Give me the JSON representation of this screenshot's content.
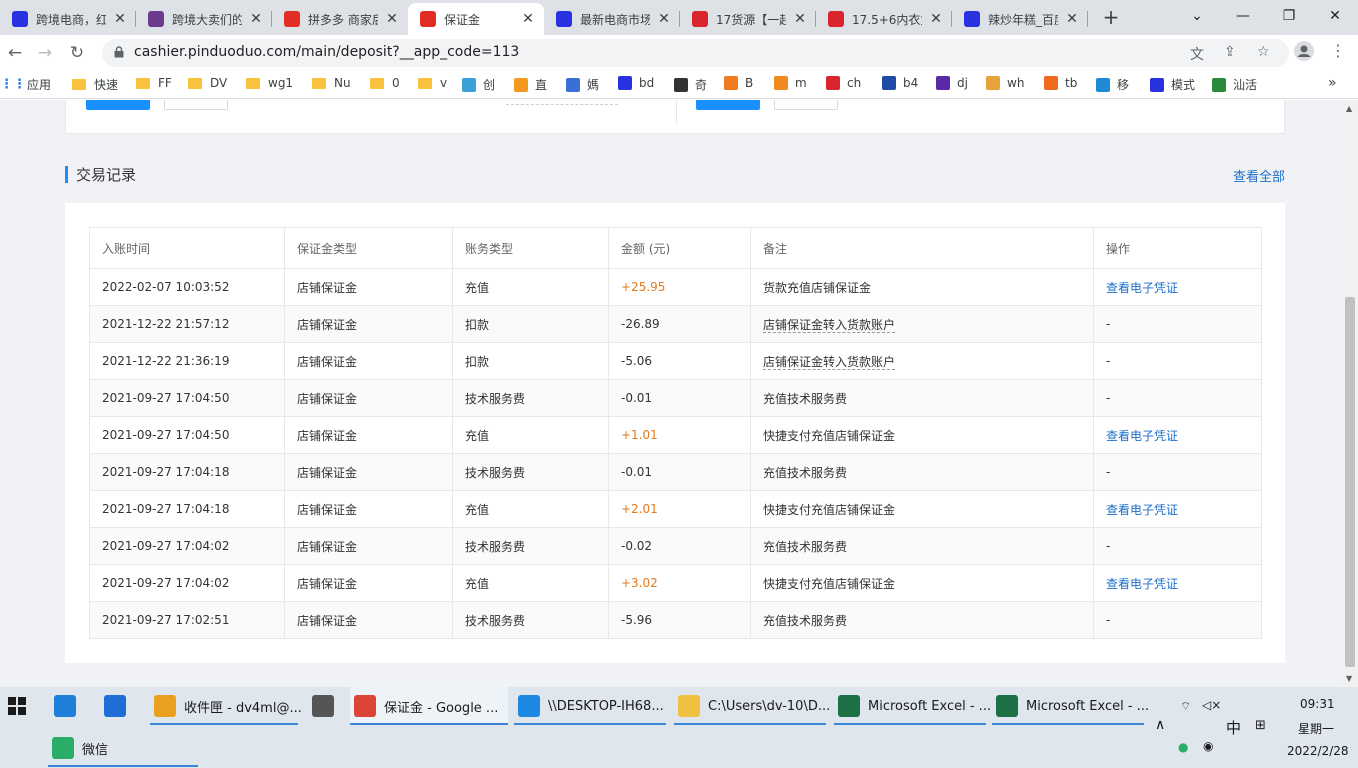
{
  "browser": {
    "tabs": [
      {
        "title": "跨境电商，红",
        "icon": "baidu-icon",
        "color": "#2932e1"
      },
      {
        "title": "跨境大卖们的",
        "icon": "zhihu-icon",
        "color": "#6b3a8c"
      },
      {
        "title": "拼多多 商家后",
        "icon": "pinduoduo-icon",
        "color": "#e02e24"
      },
      {
        "title": "保证金",
        "icon": "pinduoduo-icon",
        "color": "#e02e24",
        "active": true
      },
      {
        "title": "最新电商市场",
        "icon": "baidu-icon",
        "color": "#2932e1"
      },
      {
        "title": "17货源【一起",
        "icon": "17-icon",
        "color": "#d9262c"
      },
      {
        "title": "17.5+6内衣女",
        "icon": "17-icon",
        "color": "#d9262c"
      },
      {
        "title": "辣炒年糕_百度",
        "icon": "baidu-icon",
        "color": "#2932e1"
      }
    ],
    "url": "cashier.pinduoduo.com/main/deposit?__app_code=113",
    "bookmarks": [
      {
        "label": "应用",
        "kind": "apps"
      },
      {
        "label": "快速",
        "kind": "folder"
      },
      {
        "label": "FF",
        "kind": "folder"
      },
      {
        "label": "DV",
        "kind": "folder"
      },
      {
        "label": "wg1",
        "kind": "folder"
      },
      {
        "label": "Nu",
        "kind": "folder"
      },
      {
        "label": "0",
        "kind": "folder"
      },
      {
        "label": "v",
        "kind": "folder"
      },
      {
        "label": "创",
        "kind": "site",
        "color": "#3aa0d8"
      },
      {
        "label": "直",
        "kind": "site",
        "color": "#f39a1e"
      },
      {
        "label": "媽",
        "kind": "site",
        "color": "#3a6fd8"
      },
      {
        "label": "bd",
        "kind": "site",
        "color": "#2932e1"
      },
      {
        "label": "奇",
        "kind": "site",
        "color": "#333333"
      },
      {
        "label": "B",
        "kind": "site",
        "color": "#f07a1e"
      },
      {
        "label": "m",
        "kind": "site",
        "color": "#f08a1e"
      },
      {
        "label": "ch",
        "kind": "site",
        "color": "#d9262c"
      },
      {
        "label": "b4",
        "kind": "site",
        "color": "#1f4aa8"
      },
      {
        "label": "dj",
        "kind": "site",
        "color": "#5b2aa8"
      },
      {
        "label": "wh",
        "kind": "site",
        "color": "#e8a23a"
      },
      {
        "label": "tb",
        "kind": "site",
        "color": "#f06a1e"
      },
      {
        "label": "移",
        "kind": "site",
        "color": "#1e8ad8"
      },
      {
        "label": "模式",
        "kind": "site",
        "color": "#2932e1"
      },
      {
        "label": "汕活",
        "kind": "site",
        "color": "#2a8a3a"
      }
    ]
  },
  "section": {
    "title": "交易记录",
    "view_all": "查看全部"
  },
  "table": {
    "headers": [
      "入账时间",
      "保证金类型",
      "账务类型",
      "金额 (元)",
      "备注",
      "操作"
    ],
    "rows": [
      {
        "time": "2022-02-07 10:03:52",
        "deposit_type": "店铺保证金",
        "txn_type": "充值",
        "amount": "+25.95",
        "note": "货款充值店铺保证金",
        "action": "查看电子凭证"
      },
      {
        "time": "2021-12-22 21:57:12",
        "deposit_type": "店铺保证金",
        "txn_type": "扣款",
        "amount": "-26.89",
        "note": "店铺保证金转入货款账户",
        "action": "-"
      },
      {
        "time": "2021-12-22 21:36:19",
        "deposit_type": "店铺保证金",
        "txn_type": "扣款",
        "amount": "-5.06",
        "note": "店铺保证金转入货款账户",
        "action": "-"
      },
      {
        "time": "2021-09-27 17:04:50",
        "deposit_type": "店铺保证金",
        "txn_type": "技术服务费",
        "amount": "-0.01",
        "note": "充值技术服务费",
        "action": "-"
      },
      {
        "time": "2021-09-27 17:04:50",
        "deposit_type": "店铺保证金",
        "txn_type": "充值",
        "amount": "+1.01",
        "note": "快捷支付充值店铺保证金",
        "action": "查看电子凭证"
      },
      {
        "time": "2021-09-27 17:04:18",
        "deposit_type": "店铺保证金",
        "txn_type": "技术服务费",
        "amount": "-0.01",
        "note": "充值技术服务费",
        "action": "-"
      },
      {
        "time": "2021-09-27 17:04:18",
        "deposit_type": "店铺保证金",
        "txn_type": "充值",
        "amount": "+2.01",
        "note": "快捷支付充值店铺保证金",
        "action": "查看电子凭证"
      },
      {
        "time": "2021-09-27 17:04:02",
        "deposit_type": "店铺保证金",
        "txn_type": "技术服务费",
        "amount": "-0.02",
        "note": "充值技术服务费",
        "action": "-"
      },
      {
        "time": "2021-09-27 17:04:02",
        "deposit_type": "店铺保证金",
        "txn_type": "充值",
        "amount": "+3.02",
        "note": "快捷支付充值店铺保证金",
        "action": "查看电子凭证"
      },
      {
        "time": "2021-09-27 17:02:51",
        "deposit_type": "店铺保证金",
        "txn_type": "技术服务费",
        "amount": "-5.96",
        "note": "充值技术服务费",
        "action": "-"
      }
    ]
  },
  "taskbar": {
    "items": [
      {
        "label": "",
        "icon": "ie-icon",
        "color": "#1e7fd8"
      },
      {
        "label": "",
        "icon": "flash-icon",
        "color": "#1e6ed8"
      },
      {
        "label": "收件匣 - dv4ml@...",
        "icon": "outlook-icon",
        "color": "#e8a01e"
      },
      {
        "label": "",
        "icon": "app-icon",
        "color": "#555555"
      },
      {
        "label": "保证金 - Google ...",
        "icon": "chrome-icon",
        "color": "#db4437",
        "active": true
      },
      {
        "label": "\\\\DESKTOP-IH68...",
        "icon": "remote-desktop-icon",
        "color": "#1e88e5"
      },
      {
        "label": "C:\\Users\\dv-10\\D...",
        "icon": "folder-icon",
        "color": "#f0c040"
      },
      {
        "label": "Microsoft Excel - ...",
        "icon": "excel-icon",
        "color": "#1d7044"
      },
      {
        "label": "Microsoft Excel - ...",
        "icon": "excel-icon",
        "color": "#1d7044"
      },
      {
        "label": "微信",
        "icon": "wechat-icon",
        "color": "#2aae67"
      }
    ],
    "time": "09:31",
    "weekday": "星期一",
    "date": "2022/2/28",
    "ime": "中"
  }
}
